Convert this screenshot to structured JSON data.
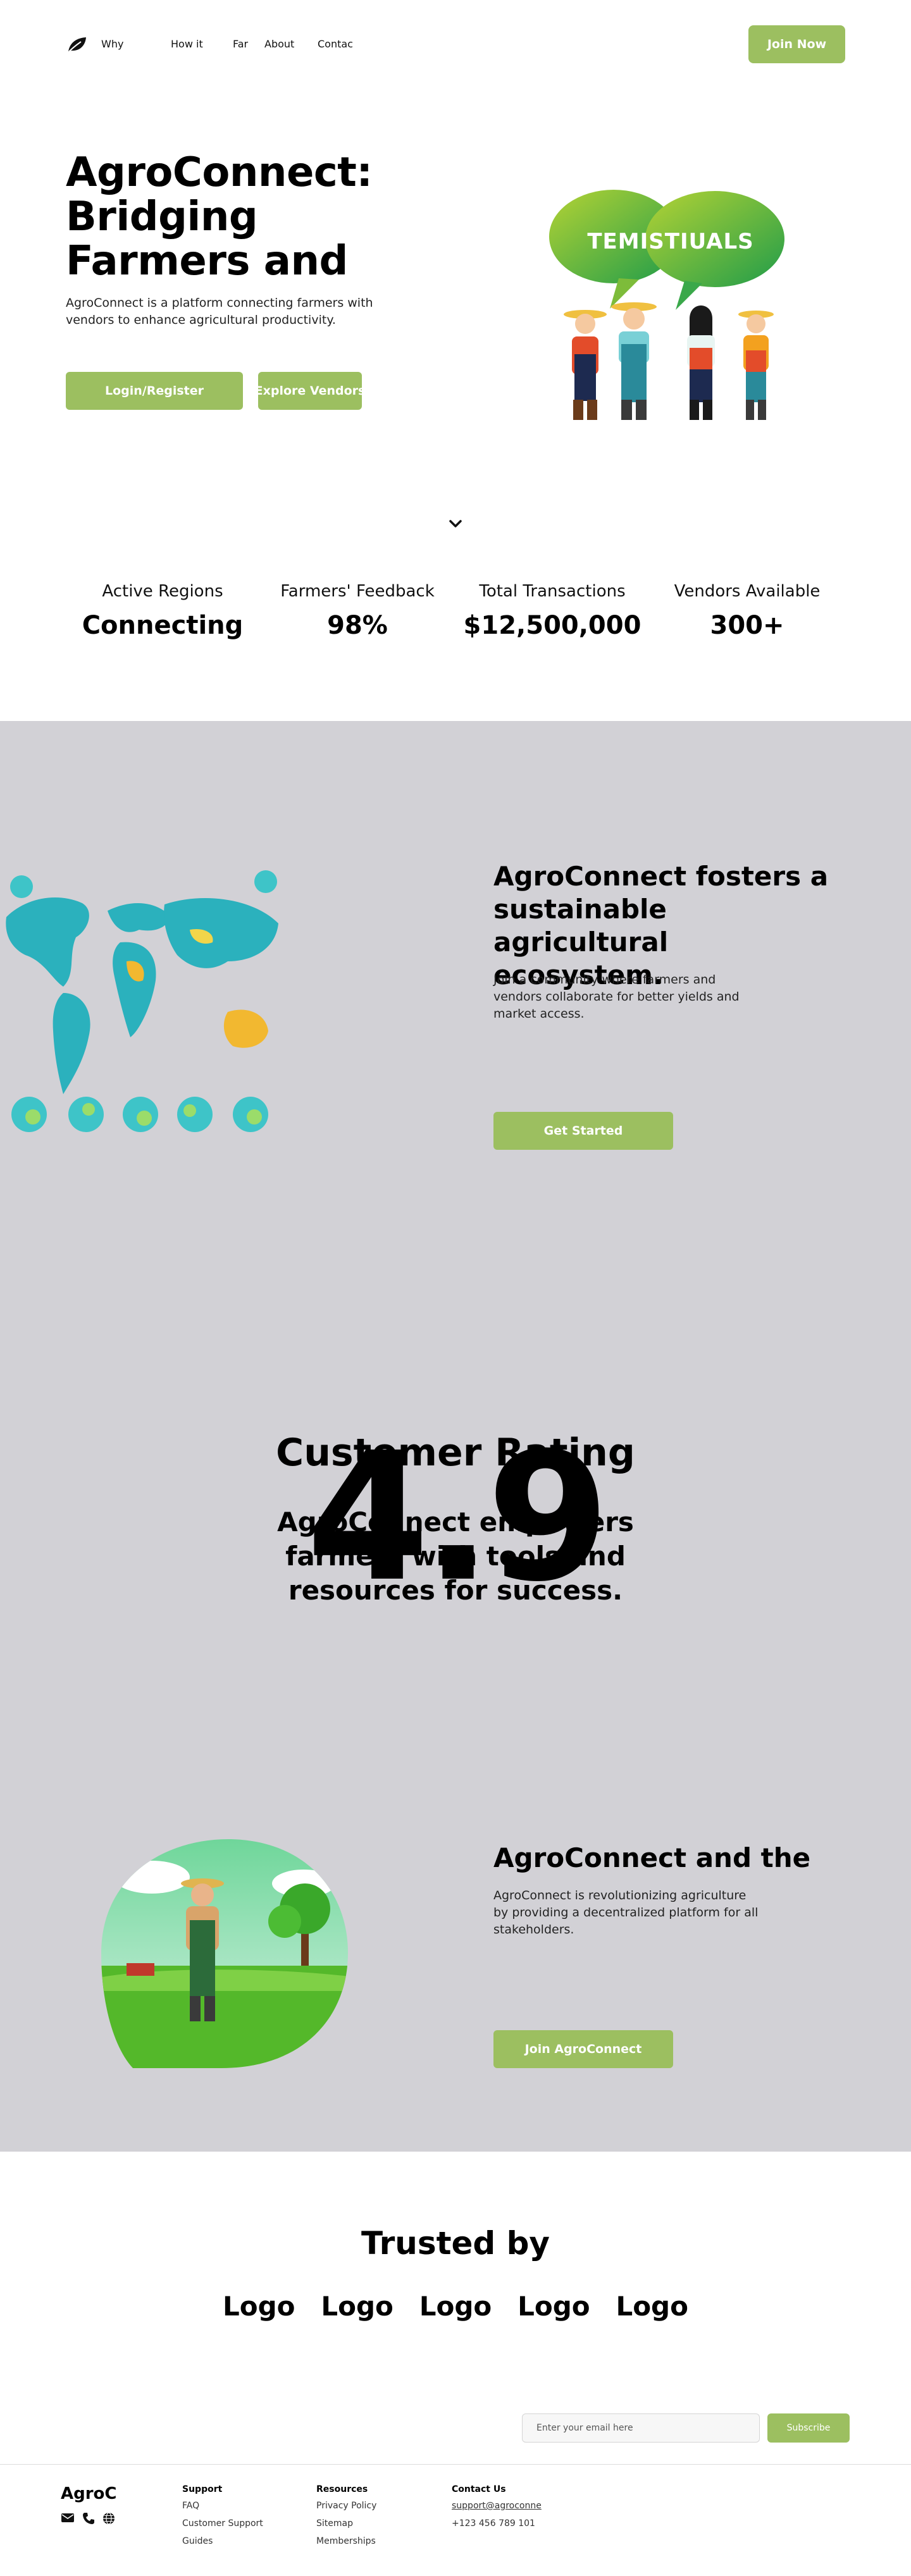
{
  "nav": {
    "links": [
      "Why",
      "How it",
      "Far",
      "About",
      "Contac"
    ],
    "cta": "Join Now"
  },
  "hero": {
    "title": "AgroConnect: Bridging Farmers and",
    "subtitle": "AgroConnect is a platform connecting farmers with vendors to enhance agricultural productivity.",
    "primary_button": "Login/Register",
    "secondary_button": "Explore Vendors",
    "bubble_text": "TEMISTIUALS"
  },
  "stats": [
    {
      "label": "Active Regions",
      "value": "Connecting"
    },
    {
      "label": "Farmers' Feedback",
      "value": "98%"
    },
    {
      "label": "Total Transactions",
      "value": "$12,500,000"
    },
    {
      "label": "Vendors Available",
      "value": "300+"
    }
  ],
  "ecosystem": {
    "title": "AgroConnect fosters a sustainable agricultural ecosystem.",
    "subtitle": "Join a community where farmers and vendors collaborate for better yields and market access.",
    "button": "Get Started"
  },
  "rating": {
    "title": "Customer Rating",
    "subtitle": "AgroConnect empowers farmers with tools and resources for success.",
    "value": "4.9"
  },
  "future": {
    "title": "AgroConnect and the",
    "subtitle": "AgroConnect is revolutionizing agriculture by providing a decentralized platform for all stakeholders.",
    "button": "Join AgroConnect"
  },
  "trusted": {
    "title": "Trusted by",
    "logos": [
      "Logo",
      "Logo",
      "Logo",
      "Logo",
      "Logo"
    ]
  },
  "newsletter": {
    "placeholder": "Enter your email here",
    "button": "Subscribe"
  },
  "footer": {
    "brand": "AgroC",
    "icons": [
      "envelope-icon",
      "phone-icon",
      "globe-icon"
    ],
    "support": {
      "heading": "Support",
      "items": [
        "FAQ",
        "Customer Support",
        "Guides"
      ]
    },
    "resources": {
      "heading": "Resources",
      "items": [
        "Privacy Policy",
        "Sitemap",
        "Memberships"
      ]
    },
    "contact": {
      "heading": "Contact Us",
      "items": [
        "support@agroconne",
        "+123 456 789 101"
      ]
    }
  },
  "colors": {
    "accent": "#9cbf60",
    "section_background": "#d2d1d6",
    "text": "#000000"
  }
}
